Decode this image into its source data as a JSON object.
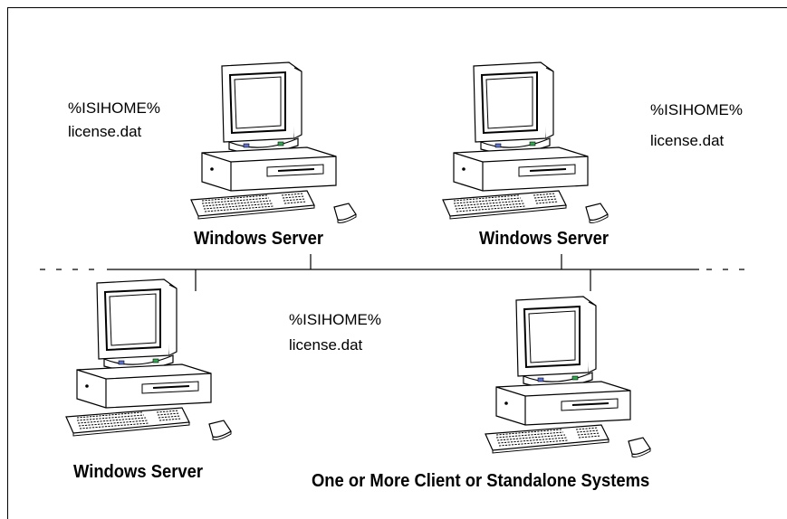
{
  "servers": [
    {
      "caption": "Windows Server",
      "path_label": "%ISIHOME%",
      "file_label": "license.dat"
    },
    {
      "caption": "Windows Server",
      "path_label": "%ISIHOME%",
      "file_label": "license.dat"
    },
    {
      "caption": "Windows Server",
      "path_label": "%ISIHOME%",
      "file_label": "license.dat"
    }
  ],
  "clients": {
    "caption": "One or More Client or Standalone Systems"
  },
  "icons": {
    "computer": "desktop-computer-icon",
    "keyboard": "keyboard-icon",
    "mouse": "mouse-icon"
  }
}
